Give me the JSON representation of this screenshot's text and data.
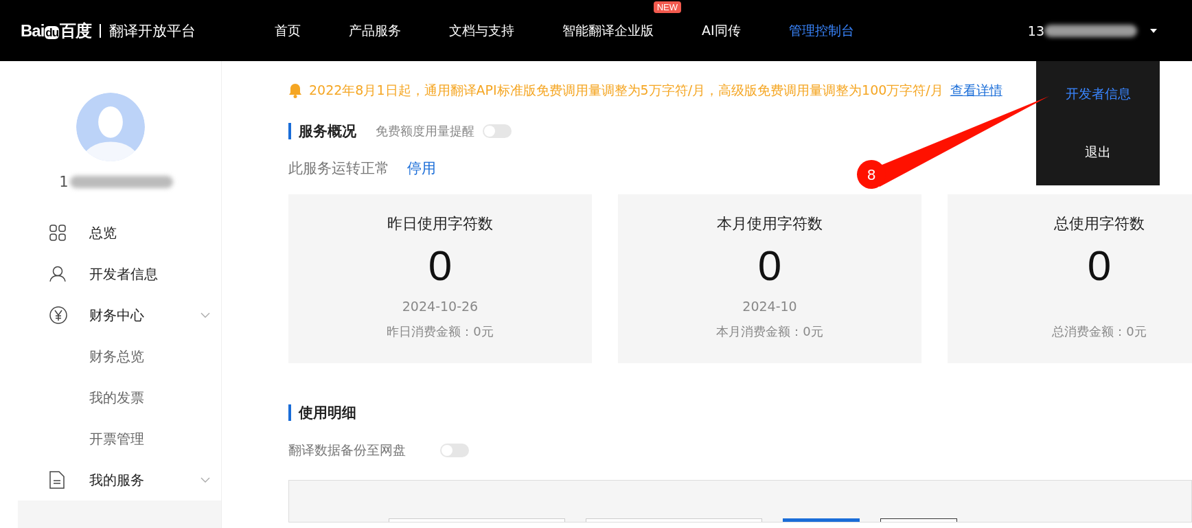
{
  "header": {
    "logo": {
      "brand": "Bai",
      "brand_mark": "du",
      "brand_cn": "百度",
      "product": "翻译开放平台"
    },
    "nav": [
      {
        "label": "首页",
        "selected": false
      },
      {
        "label": "产品服务",
        "selected": false
      },
      {
        "label": "文档与支持",
        "selected": false
      },
      {
        "label": "智能翻译企业版",
        "selected": false,
        "badge": "NEW"
      },
      {
        "label": "AI同传",
        "selected": false
      },
      {
        "label": "管理控制台",
        "selected": true
      }
    ],
    "user": "13"
  },
  "user_menu": {
    "items": [
      {
        "label": "开发者信息",
        "selected": true
      },
      {
        "label": "退出",
        "selected": false
      }
    ]
  },
  "annotation": {
    "label": "8"
  },
  "sidebar": {
    "user": "1",
    "items": [
      {
        "label": "总览",
        "selected": false
      },
      {
        "label": "开发者信息",
        "selected": false
      },
      {
        "label": "财务中心",
        "selected": false,
        "expanded": true,
        "children": [
          {
            "label": "财务总览",
            "selected": false
          },
          {
            "label": "我的发票",
            "selected": false
          },
          {
            "label": "开票管理",
            "selected": false
          }
        ]
      },
      {
        "label": "我的服务",
        "selected": false,
        "expanded": true
      }
    ]
  },
  "notice": {
    "text": "2022年8月1日起，通用翻译API标准版免费调用量调整为5万字符/月，高级版免费调用量调整为100万字符/月",
    "link": "查看详情"
  },
  "overview": {
    "title": "服务概况",
    "reminder": {
      "label": "免费额度用量提醒",
      "on": false
    },
    "status": "此服务运转正常",
    "action": "停用",
    "cards": [
      {
        "title": "昨日使用字符数",
        "value": "0",
        "date": "2024-10-26",
        "fee": "昨日消费金额：0元"
      },
      {
        "title": "本月使用字符数",
        "value": "0",
        "date": "2024-10",
        "fee": "本月消费金额：0元"
      },
      {
        "title": "总使用字符数",
        "value": "0",
        "fee": "总消费金额：0元"
      }
    ]
  },
  "details": {
    "title": "使用明细",
    "backup": {
      "label": "翻译数据备份至网盘",
      "on": false
    }
  }
}
